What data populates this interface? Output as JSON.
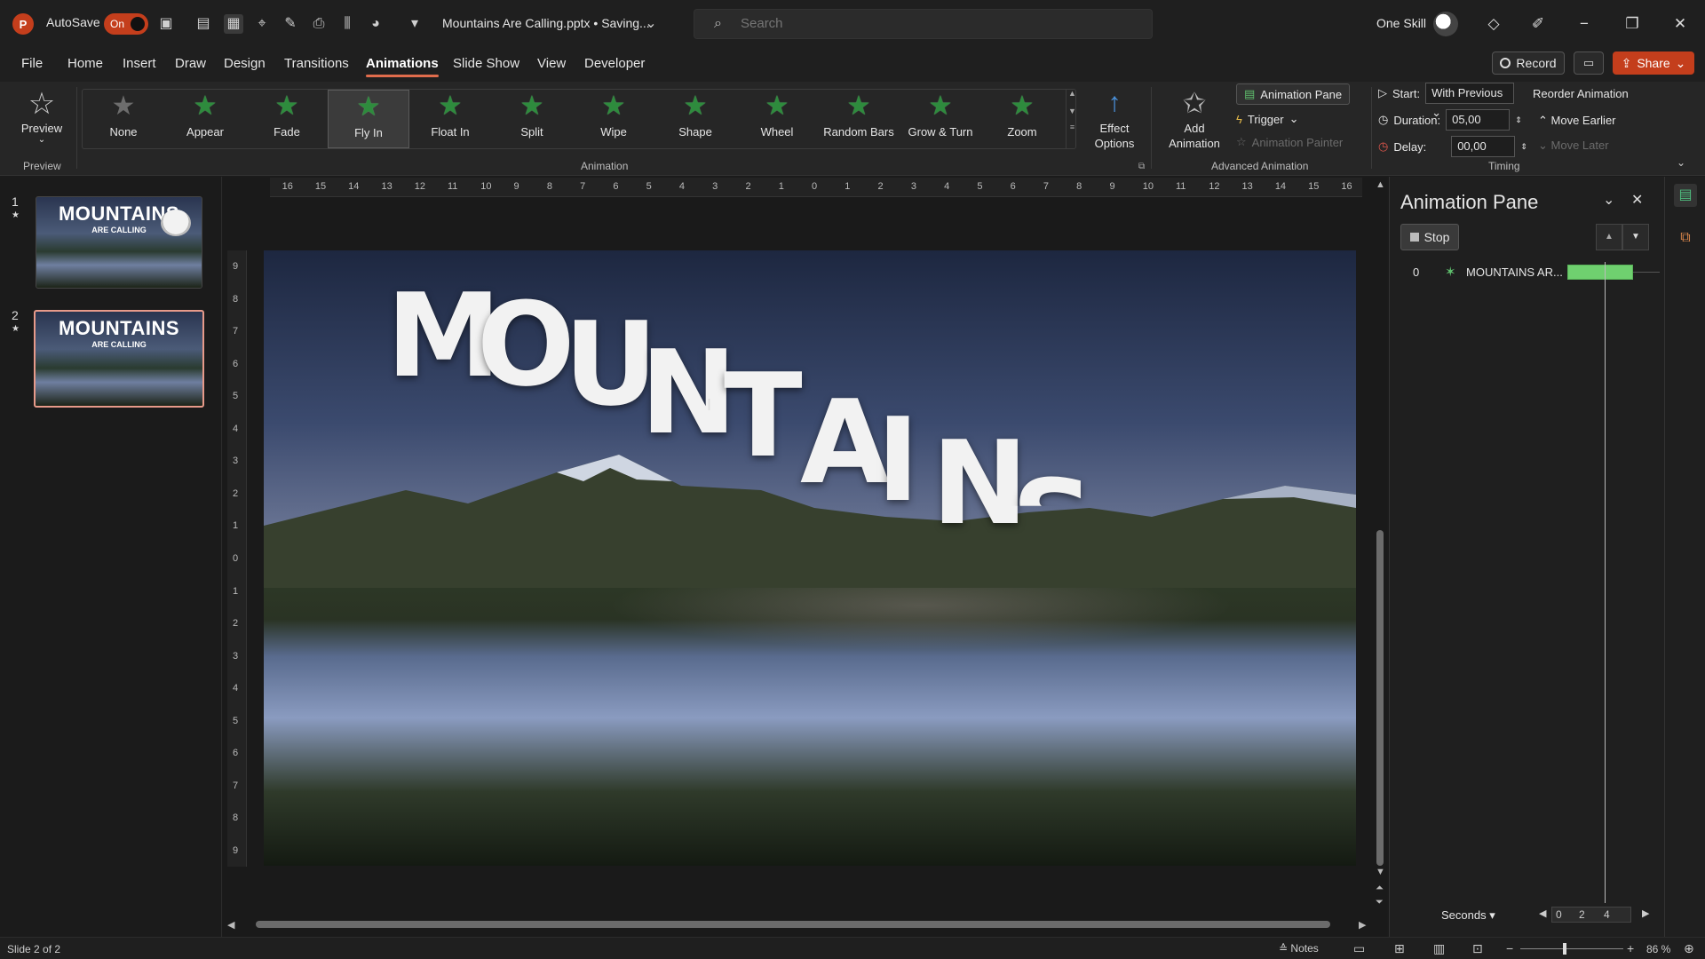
{
  "titlebar": {
    "app_logo": "P",
    "autosave_label": "AutoSave",
    "autosave_state": "On",
    "document_title": "Mountains Are Calling.pptx • Saving...",
    "search_placeholder": "Search",
    "user_name": "One Skill"
  },
  "menu": {
    "tabs": [
      "File",
      "Home",
      "Insert",
      "Draw",
      "Design",
      "Transitions",
      "Animations",
      "Slide Show",
      "View",
      "Developer"
    ],
    "active_tab": "Animations",
    "record_label": "Record",
    "share_label": "Share"
  },
  "ribbon": {
    "preview_label": "Preview",
    "preview_group": "Preview",
    "animation_group": "Animation",
    "animations": [
      "None",
      "Appear",
      "Fade",
      "Fly In",
      "Float In",
      "Split",
      "Wipe",
      "Shape",
      "Wheel",
      "Random Bars",
      "Grow & Turn",
      "Zoom"
    ],
    "selected_animation": "Fly In",
    "effect_options_line1": "Effect",
    "effect_options_line2": "Options",
    "add_animation_line1": "Add",
    "add_animation_line2": "Animation",
    "animation_pane_label": "Animation Pane",
    "trigger_label": "Trigger",
    "animation_painter_label": "Animation Painter",
    "advanced_group": "Advanced Animation",
    "start_label": "Start:",
    "start_value": "With Previous",
    "duration_label": "Duration:",
    "duration_value": "05,00",
    "delay_label": "Delay:",
    "delay_value": "00,00",
    "reorder_label": "Reorder Animation",
    "move_earlier_label": "Move Earlier",
    "move_later_label": "Move Later",
    "timing_group": "Timing"
  },
  "thumbnails": [
    {
      "number": "1",
      "title": "MOUNTAINS",
      "subtitle": "ARE CALLING"
    },
    {
      "number": "2",
      "title": "MOUNTAINS",
      "subtitle": "ARE CALLING"
    }
  ],
  "rulers": {
    "horizontal": [
      "16",
      "15",
      "14",
      "13",
      "12",
      "11",
      "10",
      "9",
      "8",
      "7",
      "6",
      "5",
      "4",
      "3",
      "2",
      "1",
      "0",
      "1",
      "2",
      "3",
      "4",
      "5",
      "6",
      "7",
      "8",
      "9",
      "10",
      "11",
      "12",
      "13",
      "14",
      "15",
      "16"
    ],
    "vertical": [
      "9",
      "8",
      "7",
      "6",
      "5",
      "4",
      "3",
      "2",
      "1",
      "0",
      "1",
      "2",
      "3",
      "4",
      "5",
      "6",
      "7",
      "8",
      "9"
    ]
  },
  "slide": {
    "letters": [
      "M",
      "O",
      "U",
      "N",
      "T",
      "A",
      "I",
      "N",
      "S"
    ]
  },
  "animation_pane": {
    "title": "Animation Pane",
    "stop_label": "Stop",
    "items": [
      {
        "index": "0",
        "name": "MOUNTAINS AR..."
      }
    ],
    "seconds_label": "Seconds",
    "scale_ticks": [
      "0",
      "2",
      "4"
    ]
  },
  "statusbar": {
    "slide_info": "Slide 2 of 2",
    "notes_label": "Notes",
    "zoom": "86 %"
  },
  "colors": {
    "accent": "#c43e1c",
    "active_tab_underline": "#e06c4c",
    "animation_bar": "#6fd06f",
    "star_green": "#2e8b3d"
  }
}
